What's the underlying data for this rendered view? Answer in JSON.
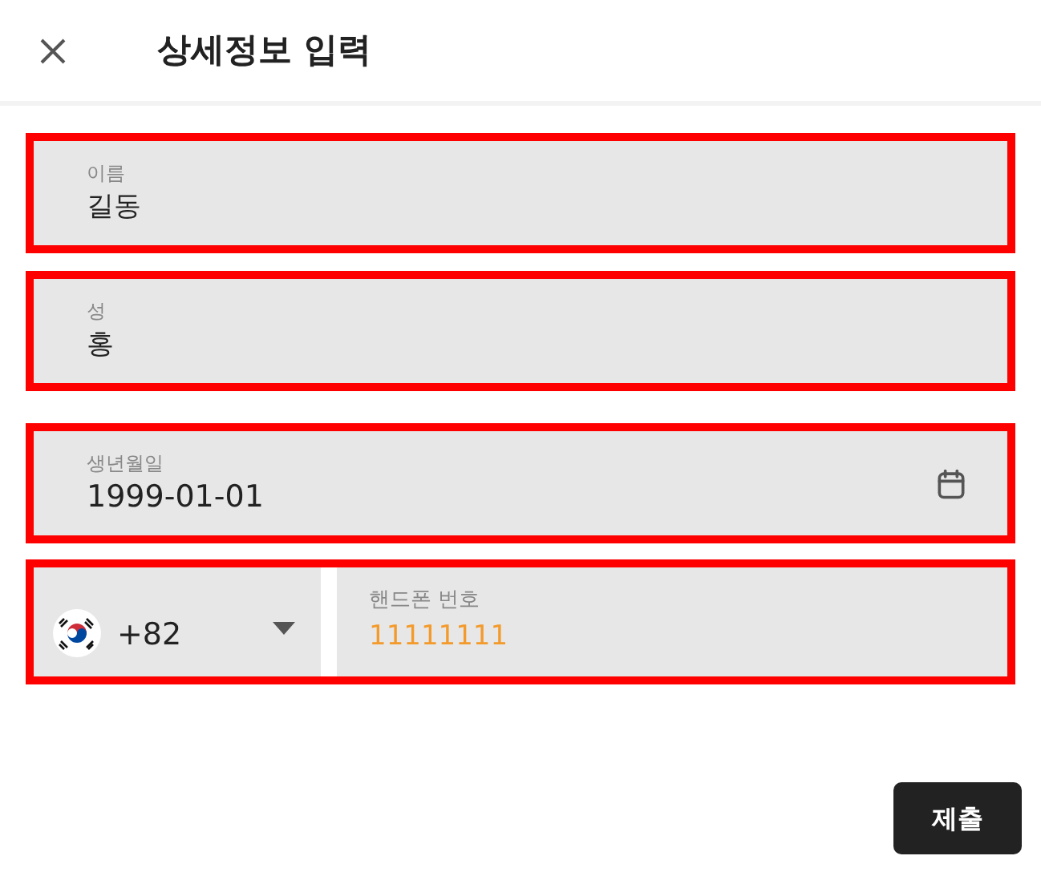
{
  "header": {
    "title": "상세정보 입력"
  },
  "fields": [
    {
      "kind": "text",
      "label": "이름",
      "value": "길동"
    },
    {
      "kind": "text",
      "label": "성",
      "value": "홍"
    },
    {
      "kind": "date",
      "label": "생년월일",
      "value": "1999-01-01"
    }
  ],
  "phone": {
    "country_code": "+82",
    "label": "핸드폰 번호",
    "value": "11111111"
  },
  "submit": "제출"
}
